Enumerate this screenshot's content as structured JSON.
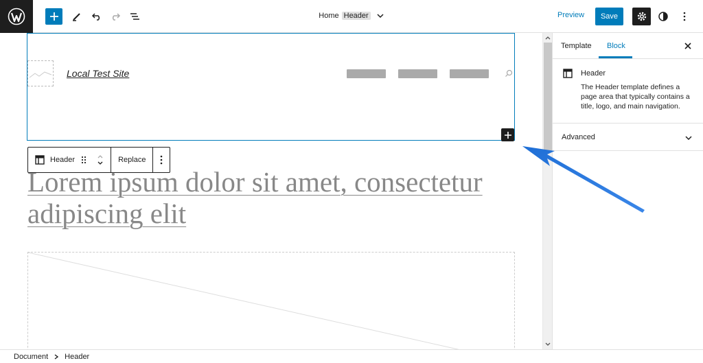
{
  "topbar": {
    "document": {
      "name": "Home",
      "badge": "Header"
    },
    "preview_label": "Preview",
    "save_label": "Save",
    "colors": {
      "accent": "#007cba",
      "dark": "#1e1e1e"
    }
  },
  "canvas": {
    "site_title": "Local Test Site",
    "block_toolbar": {
      "block_label": "Header",
      "replace_label": "Replace"
    },
    "heading": [
      "Lorem ipsum dolor sit amet, consectetur",
      "adipiscing elit"
    ]
  },
  "sidebar": {
    "tabs": [
      {
        "label": "Template"
      },
      {
        "label": "Block"
      }
    ],
    "block_card": {
      "title": "Header",
      "description": "The Header template defines a page area that typically contains a title, logo, and main navigation."
    },
    "advanced_label": "Advanced"
  },
  "footer": {
    "breadcrumb": [
      "Document",
      "Header"
    ]
  },
  "annotation": {
    "color": "#2f7de1"
  }
}
